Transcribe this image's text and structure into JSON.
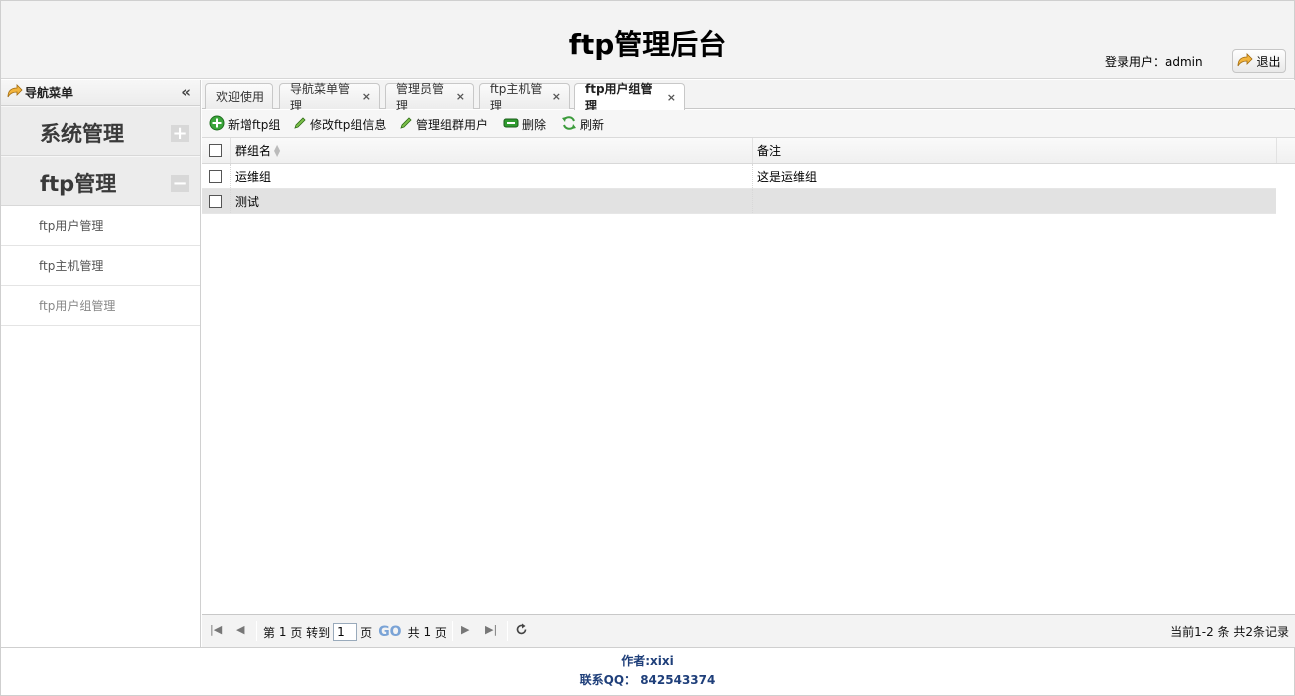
{
  "header": {
    "title": "ftp管理后台",
    "login_user_label": "登录用户：admin",
    "logout_label": "退出"
  },
  "sidebar": {
    "title": "导航菜单",
    "sections": [
      {
        "label": "系统管理",
        "expanded": false
      },
      {
        "label": "ftp管理",
        "expanded": true
      }
    ],
    "items": [
      {
        "label": "ftp用户管理"
      },
      {
        "label": "ftp主机管理"
      },
      {
        "label": "ftp用户组管理"
      }
    ]
  },
  "tabs": [
    {
      "label": "欢迎使用",
      "closable": false
    },
    {
      "label": "导航菜单管理",
      "closable": true
    },
    {
      "label": "管理员管理",
      "closable": true
    },
    {
      "label": "ftp主机管理",
      "closable": true
    },
    {
      "label": "ftp用户组管理",
      "closable": true,
      "active": true
    }
  ],
  "toolbar": {
    "add_label": "新增ftp组",
    "edit_label": "修改ftp组信息",
    "manage_label": "管理组群用户",
    "delete_label": "删除",
    "refresh_label": "刷新"
  },
  "grid": {
    "columns": [
      "群组名",
      "备注"
    ],
    "rows": [
      {
        "name": "运维组",
        "note": "这是运维组"
      },
      {
        "name": "测试",
        "note": ""
      }
    ]
  },
  "pager": {
    "page_prefix": "第",
    "current_page": "1",
    "page_suffix": "页",
    "goto_label": "转到",
    "goto_value": "1",
    "goto_suffix": "页",
    "go_label": "GO",
    "total_prefix": "共",
    "total_pages": "1",
    "total_suffix": "页",
    "summary": "当前1-2 条 共2条记录"
  },
  "footer": {
    "author": "作者:xixi",
    "contact": "联系QQ：  842543374"
  },
  "colors": {
    "header_bg": "#f3f3f3",
    "footer_text": "#1f3f7a",
    "selected_row": "#e2e2e2",
    "go_button": "#7aa3d6"
  }
}
